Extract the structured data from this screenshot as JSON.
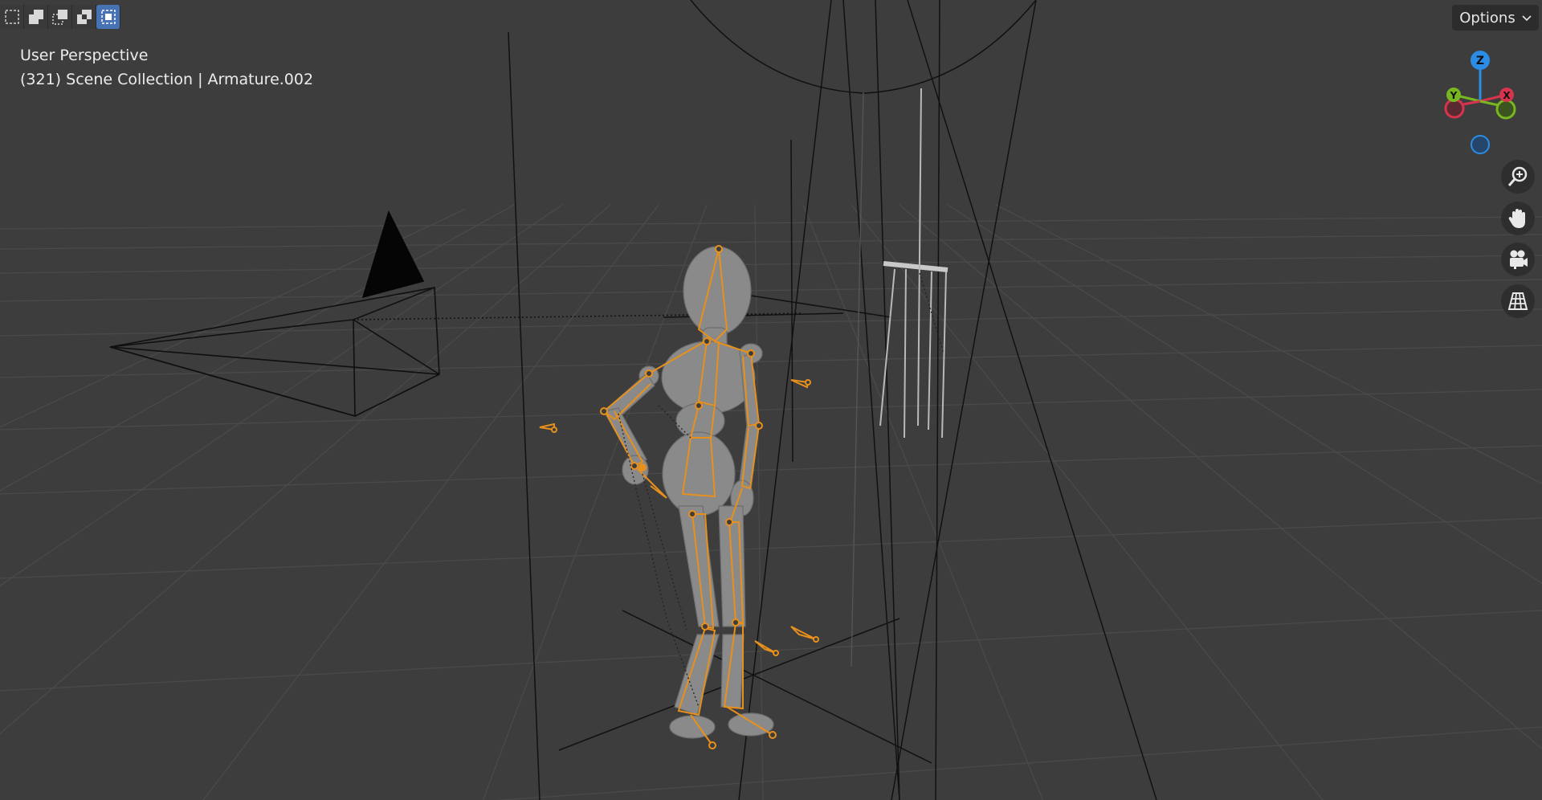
{
  "viewport": {
    "view_name": "User Perspective",
    "info": "(321) Scene Collection | Armature.002",
    "options_label": "Options",
    "accent_color": "#e8901c",
    "selection_modes": [
      {
        "icon": "select-new-icon",
        "active": false
      },
      {
        "icon": "select-extend-icon",
        "active": false
      },
      {
        "icon": "select-subtract-icon",
        "active": false
      },
      {
        "icon": "select-difference-icon",
        "active": false
      },
      {
        "icon": "select-intersect-icon",
        "active": true
      }
    ]
  },
  "gizmo": {
    "z_label": "Z",
    "y_label": "Y",
    "x_label": "X",
    "colors": {
      "x": "#d7354d",
      "y": "#78b71f",
      "z": "#2b8de6"
    }
  },
  "nav_buttons": [
    {
      "icon": "zoom-icon"
    },
    {
      "icon": "pan-hand-icon"
    },
    {
      "icon": "camera-view-icon"
    },
    {
      "icon": "perspective-grid-icon"
    }
  ]
}
